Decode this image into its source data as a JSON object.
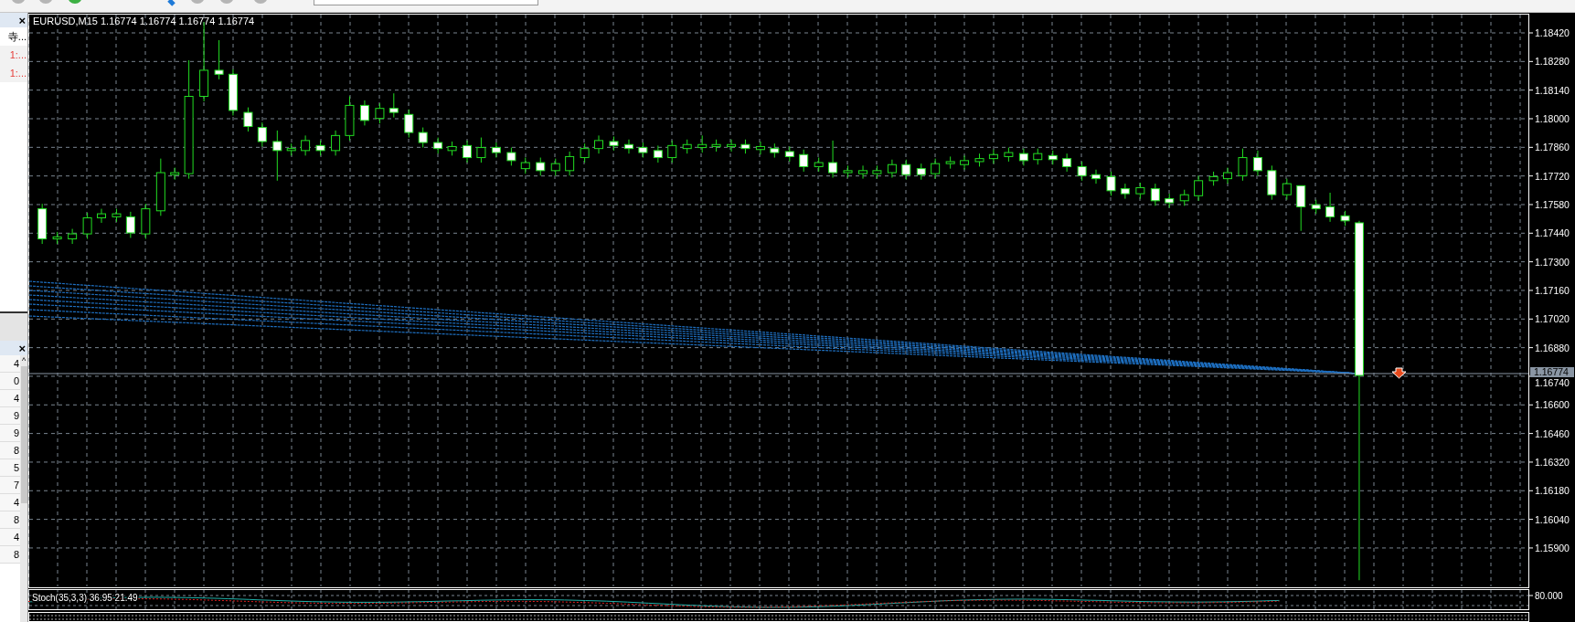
{
  "navigator_panel": {
    "close": "×",
    "items": [
      {
        "text": "寺...",
        "kind": "normal"
      },
      {
        "text": "1:...",
        "kind": "alert"
      },
      {
        "text": "1:...",
        "kind": "alert"
      }
    ]
  },
  "list_panel": {
    "close": "×",
    "scroll_up": "^",
    "rows": [
      "4",
      "0",
      "4",
      "9",
      "9",
      "8",
      "5",
      "7",
      "4",
      "8",
      "4",
      "8"
    ]
  },
  "chart": {
    "title": "EURUSD,M15  1.16774 1.16774 1.16774 1.16774",
    "price_labels": [
      "1.18420",
      "1.18280",
      "1.18140",
      "1.18000",
      "1.17860",
      "1.17720",
      "1.17580",
      "1.17440",
      "1.17300",
      "1.17160",
      "1.17020",
      "1.16880",
      "1.16740",
      "1.16600",
      "1.16460",
      "1.16320",
      "1.16180",
      "1.16040",
      "1.15900"
    ],
    "current_price": "1.16774"
  },
  "indicator": {
    "title": "Stoch(35,3,3) 36.95 21.49",
    "axis_label": "80.000"
  }
}
